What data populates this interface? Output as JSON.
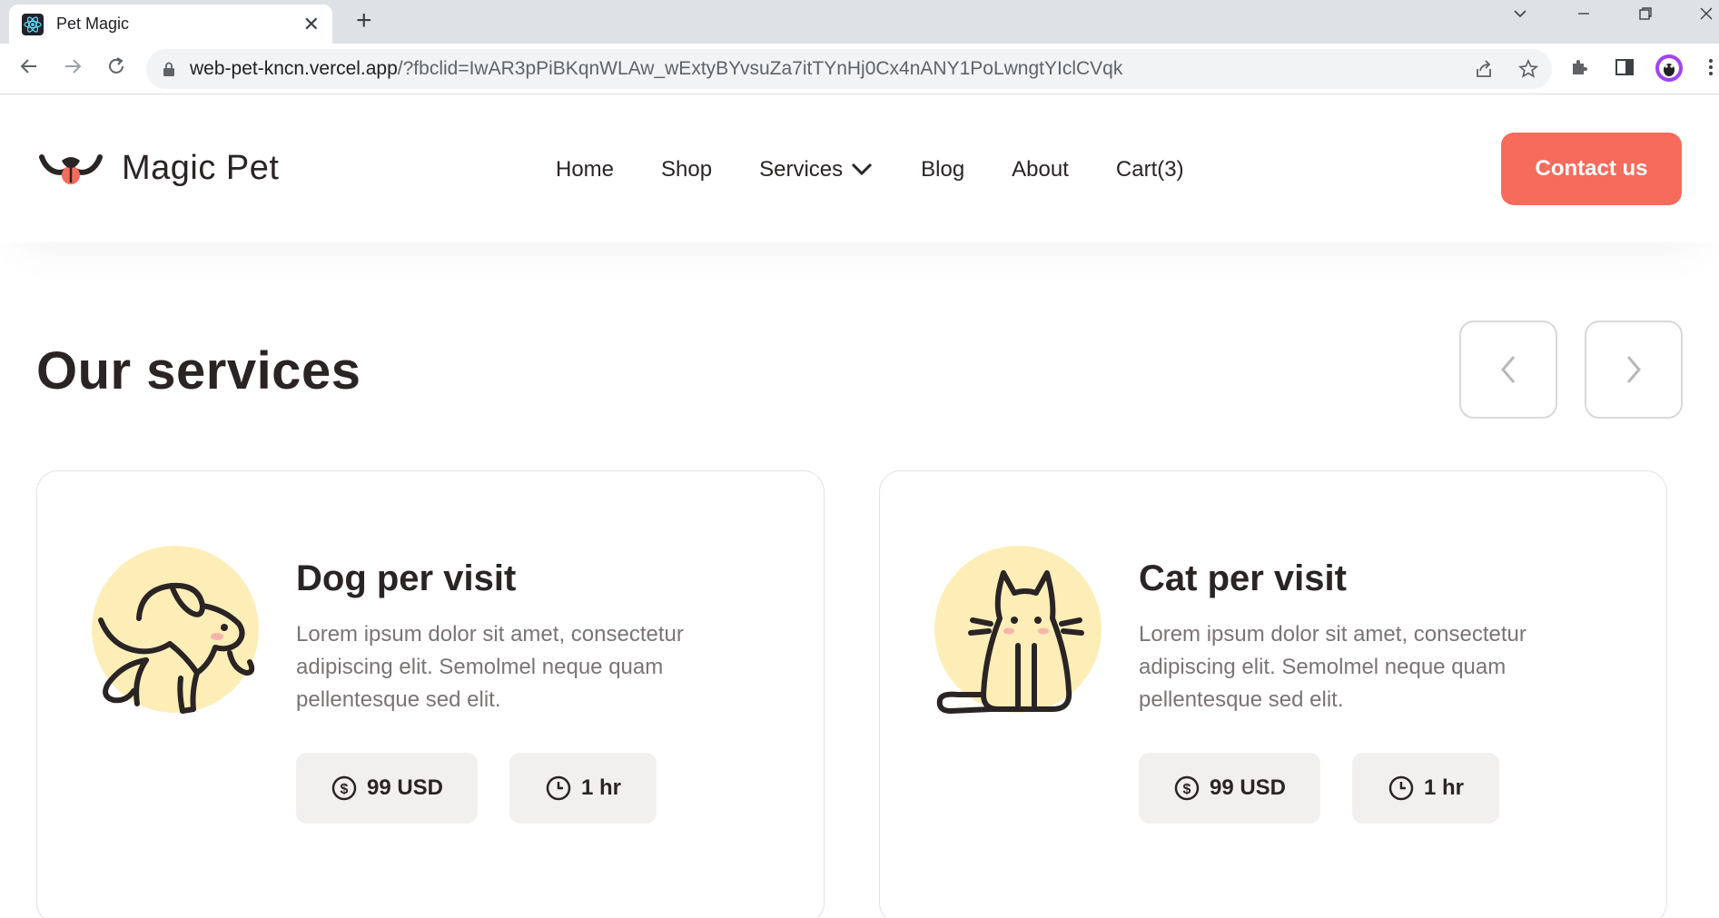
{
  "browser": {
    "tab_title": "Pet Magic",
    "url_host": "web-pet-kncn.vercel.app",
    "url_query": "/?fbclid=IwAR3pPiBKqnWLAw_wExtyBYvsuZa7itTYnHj0Cx4nANY1PoLwngtYIclCVqk"
  },
  "header": {
    "brand": "Magic Pet",
    "nav": [
      "Home",
      "Shop",
      "Services",
      "Blog",
      "About",
      "Cart(3)"
    ],
    "contact_label": "Contact us"
  },
  "services": {
    "title": "Our services",
    "prev_label": "‹",
    "next_label": "›",
    "cards": [
      {
        "title": "Dog per visit",
        "description": "Lorem ipsum dolor sit amet, consectetur adipiscing elit. Semolmel neque quam pellentesque sed elit.",
        "price": "99 USD",
        "duration": "1 hr",
        "icon": "dog-icon"
      },
      {
        "title": "Cat per visit",
        "description": "Lorem ipsum dolor sit amet, consectetur adipiscing elit. Semolmel neque quam pellentesque sed elit.",
        "price": "99 USD",
        "duration": "1 hr",
        "icon": "cat-icon"
      }
    ]
  },
  "colors": {
    "accent": "#f76b5c",
    "text": "#2a2424",
    "muted": "#7a7474",
    "illustration_bg": "#fdeeb8",
    "pill_bg": "#f2f0ef"
  }
}
